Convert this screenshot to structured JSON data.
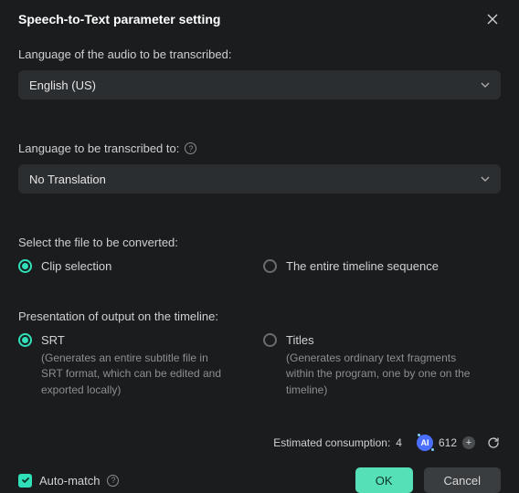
{
  "header": {
    "title": "Speech-to-Text parameter setting"
  },
  "source_lang": {
    "label": "Language of the audio to be transcribed:",
    "value": "English (US)"
  },
  "target_lang": {
    "label": "Language to be transcribed to:",
    "value": "No Translation"
  },
  "file_select": {
    "label": "Select the file to be converted:",
    "clip_label": "Clip selection",
    "timeline_label": "The entire timeline sequence"
  },
  "output": {
    "label": "Presentation of output on the timeline:",
    "srt_label": "SRT",
    "srt_desc": "(Generates an entire subtitle file in SRT format, which can be edited and exported locally)",
    "titles_label": "Titles",
    "titles_desc": "(Generates ordinary text fragments within the program, one by one on the timeline)"
  },
  "footer": {
    "estimate_label": "Estimated consumption:",
    "estimate_value": "4",
    "credits": "612",
    "ai_badge": "AI",
    "auto_match_label": "Auto-match",
    "ok_label": "OK",
    "cancel_label": "Cancel"
  }
}
